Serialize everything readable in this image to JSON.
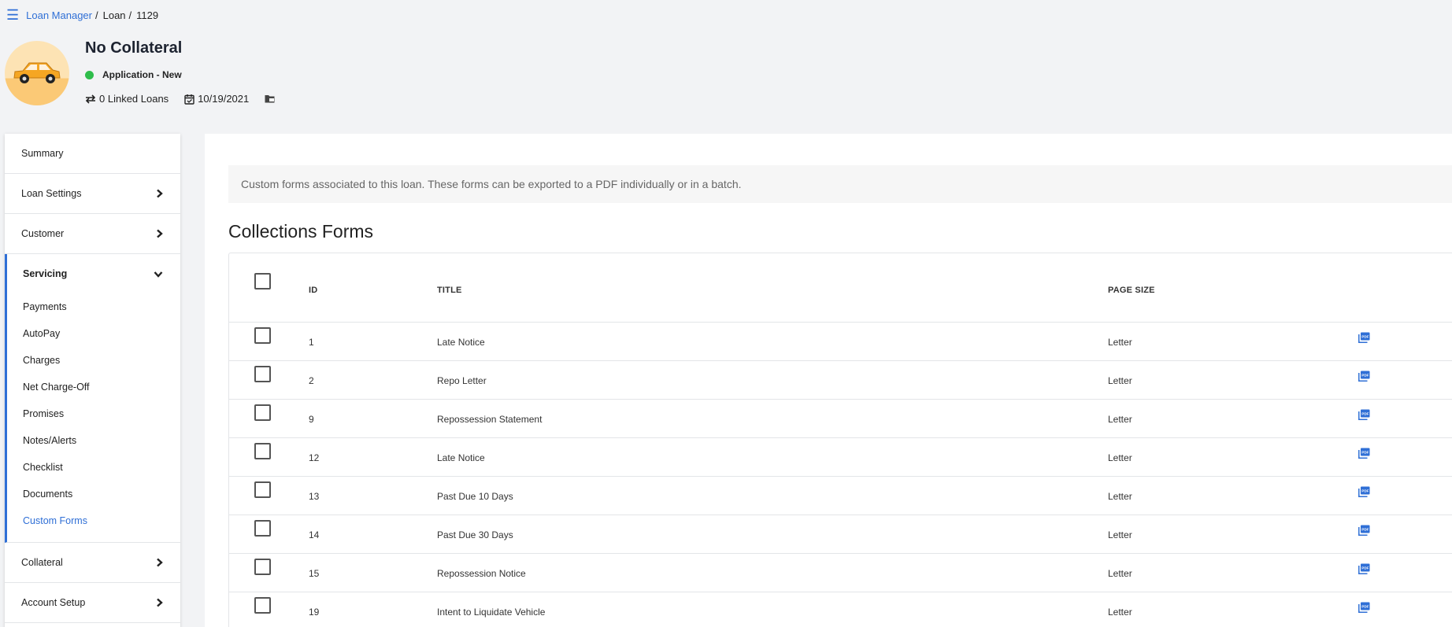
{
  "breadcrumb": {
    "menu_icon": "hamburger-icon",
    "root": "Loan Manager",
    "section": "Loan",
    "loan_id": "1129"
  },
  "loan": {
    "title": "No Collateral",
    "status": "Application - New",
    "status_color": "#2fbd4b",
    "linked_loans": "0 Linked Loans",
    "date": "10/19/2021",
    "avatar_icon": "car-icon"
  },
  "sidebar": {
    "summary": "Summary",
    "loan_settings": "Loan Settings",
    "customer": "Customer",
    "servicing": {
      "label": "Servicing",
      "items": [
        "Payments",
        "AutoPay",
        "Charges",
        "Net Charge-Off",
        "Promises",
        "Notes/Alerts",
        "Checklist",
        "Documents",
        "Custom Forms"
      ],
      "active": "Custom Forms"
    },
    "collateral": "Collateral",
    "account_setup": "Account Setup"
  },
  "main": {
    "info": "Custom forms associated to this loan. These forms can be exported to a PDF individually or in a batch.",
    "section_title": "Collections Forms",
    "columns": {
      "id": "ID",
      "title": "TITLE",
      "page_size": "PAGE SIZE"
    },
    "rows": [
      {
        "id": "1",
        "title": "Late Notice",
        "page_size": "Letter"
      },
      {
        "id": "2",
        "title": "Repo Letter",
        "page_size": "Letter"
      },
      {
        "id": "9",
        "title": "Repossession Statement",
        "page_size": "Letter"
      },
      {
        "id": "12",
        "title": "Late Notice",
        "page_size": "Letter"
      },
      {
        "id": "13",
        "title": "Past Due 10 Days",
        "page_size": "Letter"
      },
      {
        "id": "14",
        "title": "Past Due 30 Days",
        "page_size": "Letter"
      },
      {
        "id": "15",
        "title": "Repossession Notice",
        "page_size": "Letter"
      },
      {
        "id": "19",
        "title": "Intent to Liquidate Vehicle",
        "page_size": "Letter"
      }
    ]
  },
  "colors": {
    "accent": "#2f6fd6",
    "background": "#f2f3f5"
  }
}
